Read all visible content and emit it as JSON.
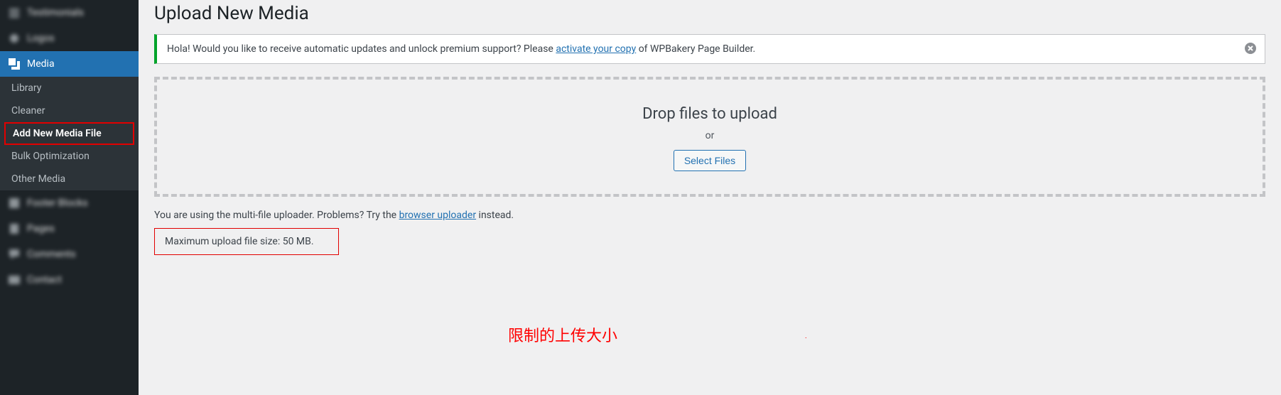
{
  "sidebar": {
    "blurred_top": [
      {
        "label": "Testimonials"
      },
      {
        "label": "Logos"
      }
    ],
    "media_label": "Media",
    "sub": [
      {
        "label": "Library"
      },
      {
        "label": "Cleaner"
      },
      {
        "label": "Add New Media File"
      },
      {
        "label": "Bulk Optimization"
      },
      {
        "label": "Other Media"
      }
    ],
    "blurred_bottom": [
      {
        "label": "Footer Blocks"
      },
      {
        "label": "Pages"
      },
      {
        "label": "Comments"
      },
      {
        "label": "Contact"
      }
    ]
  },
  "page": {
    "title": "Upload New Media",
    "notice_pre": "Hola! Would you like to receive automatic updates and unlock premium support? Please ",
    "notice_link": "activate your copy",
    "notice_post": " of WPBakery Page Builder.",
    "drop_title": "Drop files to upload",
    "drop_or": "or",
    "select_btn": "Select Files",
    "hint_pre": "You are using the multi-file uploader. Problems? Try the ",
    "hint_link": "browser uploader",
    "hint_post": " instead.",
    "max_size": "Maximum upload file size: 50 MB."
  },
  "annotation": {
    "cn_text": "限制的上传大小"
  }
}
